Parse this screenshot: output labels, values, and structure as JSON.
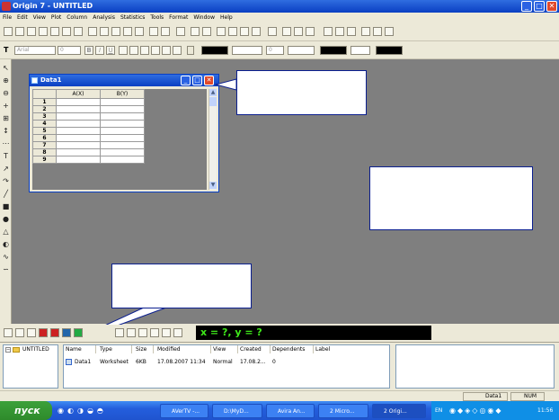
{
  "app": {
    "title": "Origin 7 - UNTITLED"
  },
  "menu": [
    "File",
    "Edit",
    "View",
    "Plot",
    "Column",
    "Analysis",
    "Statistics",
    "Tools",
    "Format",
    "Window",
    "Help"
  ],
  "format_toolbar": {
    "font_combo": "Arial",
    "size_combo": "0",
    "color_combo": "0"
  },
  "worksheet": {
    "title": "Data1",
    "columns": [
      "A(X)",
      "B(Y)"
    ],
    "rows": [
      "1",
      "2",
      "3",
      "4",
      "5",
      "6",
      "7",
      "8",
      "9"
    ]
  },
  "coords_readout": "x = ?, y = ?",
  "project_explorer": {
    "folder": "UNTITLED",
    "headers": [
      "Name",
      "Type",
      "Size",
      "Modified",
      "View",
      "Created",
      "Dependents",
      "Label"
    ],
    "row": {
      "name": "Data1",
      "type": "Worksheet",
      "size": "6KB",
      "modified": "17.08.2007 11:34",
      "view": "Normal",
      "created": "17.08.2...",
      "dependents": "0"
    }
  },
  "status": {
    "window": "Data1",
    "num": "NUM"
  },
  "taskbar": {
    "start": "пуск",
    "tasks": [
      "AVerTV -...",
      "D:\\MyD...",
      "Avira An...",
      "2 Micro...",
      "2 Origi..."
    ],
    "lang": "EN",
    "time": "11:56"
  }
}
